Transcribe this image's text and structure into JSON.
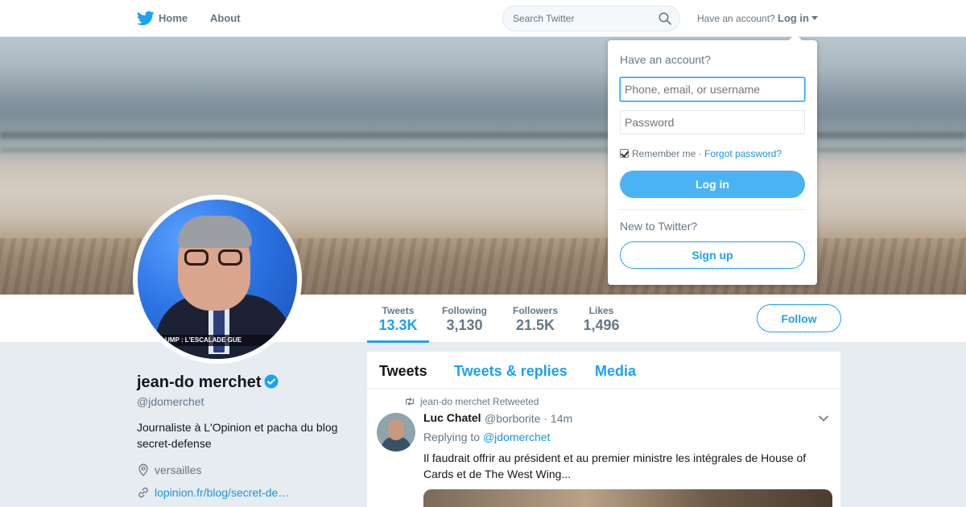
{
  "nav": {
    "home": "Home",
    "about": "About",
    "search_placeholder": "Search Twitter",
    "have_account": "Have an account?",
    "login": "Log in"
  },
  "login_dropdown": {
    "title": "Have an account?",
    "username_placeholder": "Phone, email, or username",
    "password_placeholder": "Password",
    "remember_me": "Remember me",
    "separator": "·",
    "forgot_password": "Forgot password?",
    "login_button": "Log in",
    "new_to_twitter": "New to Twitter?",
    "signup_button": "Sign up"
  },
  "avatar_caption": "UMP : L'ESCALADE GUE",
  "profile_nav": {
    "stats": [
      {
        "label": "Tweets",
        "value": "13.3K"
      },
      {
        "label": "Following",
        "value": "3,130"
      },
      {
        "label": "Followers",
        "value": "21.5K"
      },
      {
        "label": "Likes",
        "value": "1,496"
      }
    ],
    "follow_button": "Follow"
  },
  "profile": {
    "name": "jean-do merchet",
    "handle": "@jdomerchet",
    "bio": "Journaliste à L'Opinion et pacha du blog secret-defense",
    "location": "versailles",
    "link": "lopinion.fr/blog/secret-de…"
  },
  "timeline": {
    "tabs": [
      "Tweets",
      "Tweets & replies",
      "Media"
    ],
    "tweet": {
      "retweet_context": "jean-do merchet Retweeted",
      "author_name": "Luc Chatel",
      "author_handle": "@borborite",
      "time": "· 14m",
      "replying_to_label": "Replying to",
      "replying_to_handle": "@jdomerchet",
      "text": "Il faudrait offrir au président et au premier ministre les intégrales de House of Cards et de The West Wing..."
    }
  },
  "colors": {
    "accent": "#1da1f2",
    "link": "#1b95e0",
    "muted": "#657786",
    "background": "#e6ecf0"
  }
}
